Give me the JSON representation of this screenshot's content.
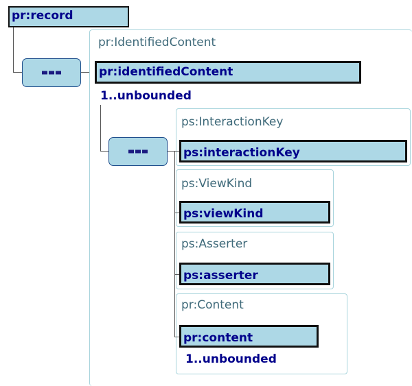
{
  "root": {
    "name": "pr:record"
  },
  "identified_content": {
    "type": "pr:IdentifiedContent",
    "name": "pr:identifiedContent",
    "cardinality": "1..unbounded"
  },
  "children": [
    {
      "type": "ps:InteractionKey",
      "name": "ps:interactionKey"
    },
    {
      "type": "ps:ViewKind",
      "name": "ps:viewKind"
    },
    {
      "type": "ps:Asserter",
      "name": "ps:asserter"
    },
    {
      "type": "pr:Content",
      "name": "pr:content",
      "cardinality": "1..unbounded"
    }
  ]
}
